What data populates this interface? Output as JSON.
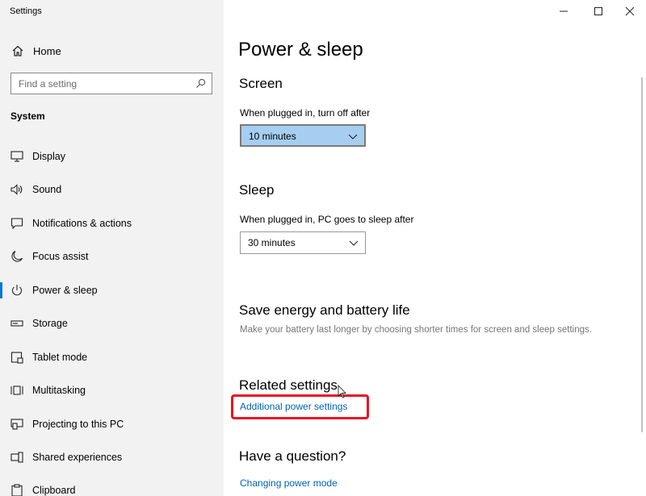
{
  "window": {
    "title": "Settings"
  },
  "sidebar": {
    "home_label": "Home",
    "search_placeholder": "Find a setting",
    "section": "System",
    "items": [
      {
        "label": "Display",
        "icon": "display-icon"
      },
      {
        "label": "Sound",
        "icon": "sound-icon"
      },
      {
        "label": "Notifications & actions",
        "icon": "notifications-icon"
      },
      {
        "label": "Focus assist",
        "icon": "moon-icon"
      },
      {
        "label": "Power & sleep",
        "icon": "power-icon",
        "active": true
      },
      {
        "label": "Storage",
        "icon": "storage-icon"
      },
      {
        "label": "Tablet mode",
        "icon": "tablet-icon"
      },
      {
        "label": "Multitasking",
        "icon": "multitasking-icon"
      },
      {
        "label": "Projecting to this PC",
        "icon": "projecting-icon"
      },
      {
        "label": "Shared experiences",
        "icon": "shared-experiences-icon"
      },
      {
        "label": "Clipboard",
        "icon": "clipboard-icon"
      }
    ]
  },
  "main": {
    "title": "Power & sleep",
    "screen": {
      "heading": "Screen",
      "label": "When plugged in, turn off after",
      "value": "10 minutes"
    },
    "sleep": {
      "heading": "Sleep",
      "label": "When plugged in, PC goes to sleep after",
      "value": "30 minutes"
    },
    "save_energy": {
      "heading": "Save energy and battery life",
      "description": "Make your battery last longer by choosing shorter times for screen and sleep settings."
    },
    "related": {
      "heading": "Related settings",
      "link": "Additional power settings"
    },
    "question": {
      "heading": "Have a question?",
      "link": "Changing power mode"
    }
  },
  "colors": {
    "accent": "#0078d7",
    "link": "#0063b1",
    "highlight": "#e81123",
    "sidebar_bg": "#f2f2f2",
    "selected_dropdown": "#a6cef0"
  }
}
